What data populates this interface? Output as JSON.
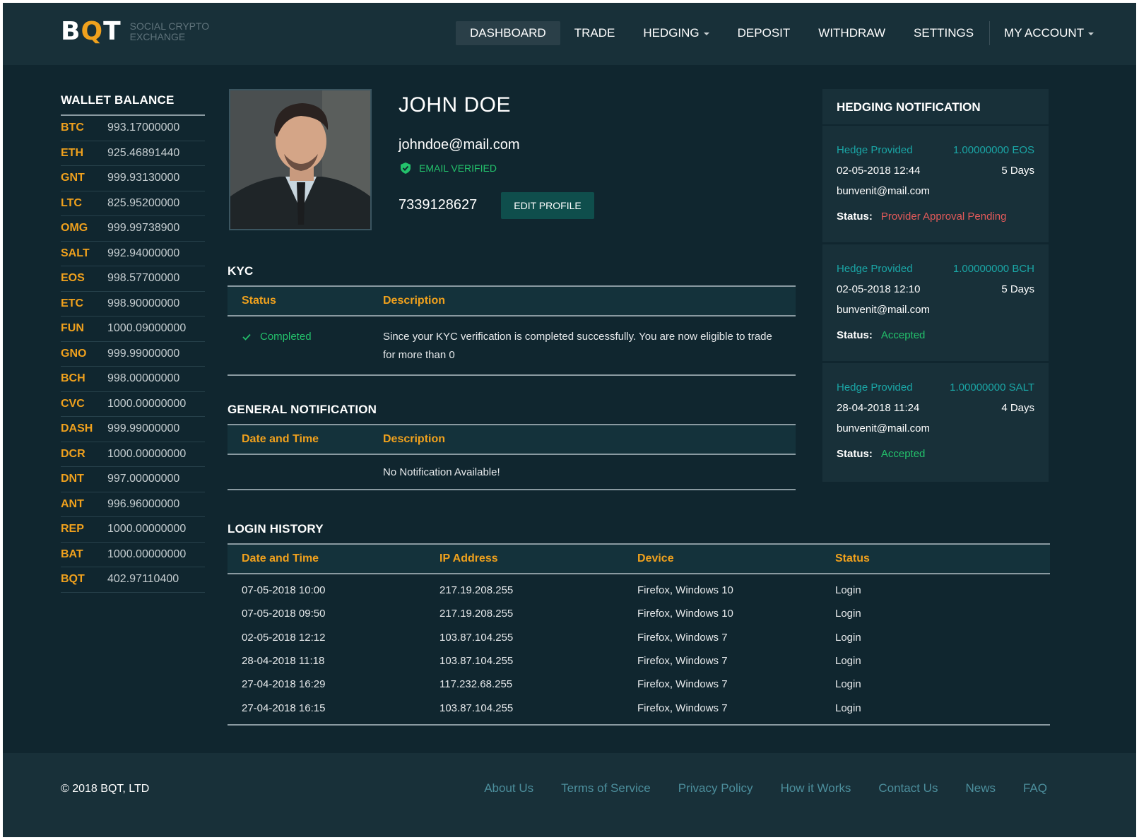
{
  "brand": {
    "mark_left": "B",
    "mark_q": "Q",
    "mark_right": "T",
    "tagline_1": "SOCIAL CRYPTO",
    "tagline_2": "EXCHANGE"
  },
  "nav": {
    "dashboard": "DASHBOARD",
    "trade": "TRADE",
    "hedging": "HEDGING",
    "deposit": "DEPOSIT",
    "withdraw": "WITHDRAW",
    "settings": "SETTINGS",
    "my_account": "MY ACCOUNT"
  },
  "wallet": {
    "title": "WALLET BALANCE",
    "items": [
      {
        "symbol": "BTC",
        "amount": "993.17000000"
      },
      {
        "symbol": "ETH",
        "amount": "925.46891440"
      },
      {
        "symbol": "GNT",
        "amount": "999.93130000"
      },
      {
        "symbol": "LTC",
        "amount": "825.95200000"
      },
      {
        "symbol": "OMG",
        "amount": "999.99738900"
      },
      {
        "symbol": "SALT",
        "amount": "992.94000000"
      },
      {
        "symbol": "EOS",
        "amount": "998.57700000"
      },
      {
        "symbol": "ETC",
        "amount": "998.90000000"
      },
      {
        "symbol": "FUN",
        "amount": "1000.09000000"
      },
      {
        "symbol": "GNO",
        "amount": "999.99000000"
      },
      {
        "symbol": "BCH",
        "amount": "998.00000000"
      },
      {
        "symbol": "CVC",
        "amount": "1000.00000000"
      },
      {
        "symbol": "DASH",
        "amount": "999.99000000"
      },
      {
        "symbol": "DCR",
        "amount": "1000.00000000"
      },
      {
        "symbol": "DNT",
        "amount": "997.00000000"
      },
      {
        "symbol": "ANT",
        "amount": "996.96000000"
      },
      {
        "symbol": "REP",
        "amount": "1000.00000000"
      },
      {
        "symbol": "BAT",
        "amount": "1000.00000000"
      },
      {
        "symbol": "BQT",
        "amount": "402.97110400"
      }
    ]
  },
  "profile": {
    "name": "JOHN DOE",
    "email": "johndoe@mail.com",
    "verified_label": "EMAIL VERIFIED",
    "phone": "7339128627",
    "edit_label": "EDIT PROFILE"
  },
  "kyc": {
    "title": "KYC",
    "col_status": "Status",
    "col_description": "Description",
    "status": "Completed",
    "description": "Since your KYC verification is completed successfully. You are now eligible to trade for more than 0"
  },
  "general": {
    "title": "GENERAL NOTIFICATION",
    "col_datetime": "Date and Time",
    "col_description": "Description",
    "empty": "No Notification Available!"
  },
  "login_history": {
    "title": "LOGIN HISTORY",
    "columns": [
      "Date and Time",
      "IP Address",
      "Device",
      "Status"
    ],
    "rows": [
      [
        "07-05-2018 10:00",
        "217.19.208.255",
        "Firefox, Windows 10",
        "Login"
      ],
      [
        "07-05-2018 09:50",
        "217.19.208.255",
        "Firefox, Windows 10",
        "Login"
      ],
      [
        "02-05-2018 12:12",
        "103.87.104.255",
        "Firefox, Windows 7",
        "Login"
      ],
      [
        "28-04-2018 11:18",
        "103.87.104.255",
        "Firefox, Windows 7",
        "Login"
      ],
      [
        "27-04-2018 16:29",
        "117.232.68.255",
        "Firefox, Windows 7",
        "Login"
      ],
      [
        "27-04-2018 16:15",
        "103.87.104.255",
        "Firefox, Windows 7",
        "Login"
      ]
    ]
  },
  "hedging": {
    "title": "HEDGING NOTIFICATION",
    "status_label": "Status:",
    "items": [
      {
        "type": "Hedge Provided",
        "amount": "1.00000000 EOS",
        "datetime": "02-05-2018 12:44",
        "duration": "5 Days",
        "email": "bunvenit@mail.com",
        "status": "Provider Approval Pending",
        "status_kind": "pending"
      },
      {
        "type": "Hedge Provided",
        "amount": "1.00000000 BCH",
        "datetime": "02-05-2018 12:10",
        "duration": "5 Days",
        "email": "bunvenit@mail.com",
        "status": "Accepted",
        "status_kind": "accepted"
      },
      {
        "type": "Hedge Provided",
        "amount": "1.00000000 SALT",
        "datetime": "28-04-2018 11:24",
        "duration": "4 Days",
        "email": "bunvenit@mail.com",
        "status": "Accepted",
        "status_kind": "accepted"
      }
    ]
  },
  "footer": {
    "copyright": "© 2018 BQT, LTD",
    "links": [
      "About Us",
      "Terms of Service",
      "Privacy Policy",
      "How it Works",
      "Contact Us",
      "News",
      "FAQ"
    ]
  },
  "colors": {
    "background": "#10262f",
    "panel": "#183039",
    "accent": "#f0a11d",
    "success": "#23c16b",
    "danger": "#e35a5a",
    "teal": "#1aa6a6",
    "link": "#4c8e9c"
  }
}
